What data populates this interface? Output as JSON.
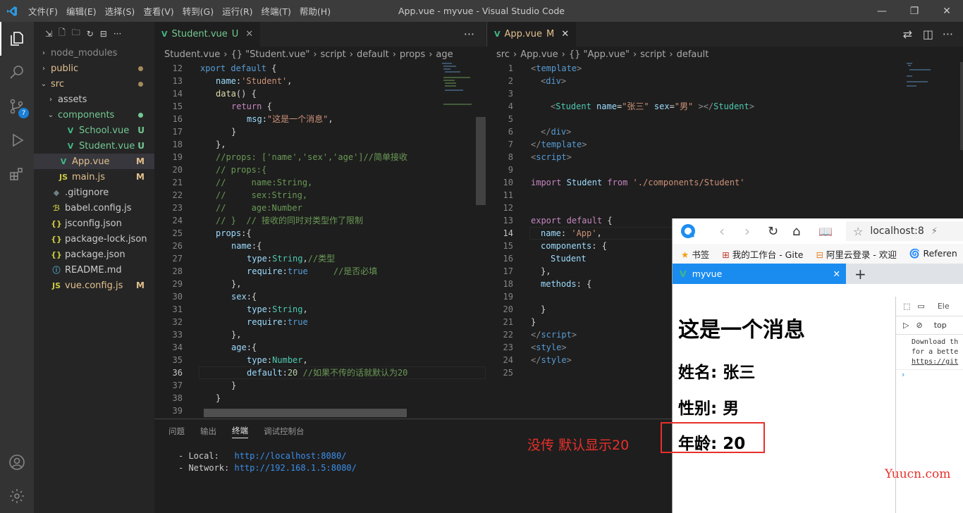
{
  "window": {
    "title": "App.vue - myvue - Visual Studio Code",
    "menu": [
      "文件(F)",
      "编辑(E)",
      "选择(S)",
      "查看(V)",
      "转到(G)",
      "运行(R)",
      "终端(T)",
      "帮助(H)"
    ],
    "controls": [
      "—",
      "❐",
      "✕"
    ]
  },
  "activity": {
    "scm_badge": "7"
  },
  "explorer": {
    "items": [
      {
        "label": "node_modules",
        "indent": 1,
        "chev": "›",
        "icon": "",
        "status": "",
        "color": "gray"
      },
      {
        "label": "public",
        "indent": 1,
        "chev": "›",
        "icon": "",
        "status": "dot",
        "color": "orange"
      },
      {
        "label": "src",
        "indent": 1,
        "chev": "⌄",
        "icon": "",
        "status": "dot",
        "color": "orange"
      },
      {
        "label": "assets",
        "indent": 2,
        "chev": "›",
        "icon": "",
        "status": "",
        "color": "plain"
      },
      {
        "label": "components",
        "indent": 2,
        "chev": "⌄",
        "icon": "",
        "status": "dotg",
        "color": "green"
      },
      {
        "label": "School.vue",
        "indent": 3,
        "chev": "",
        "icon": "V",
        "status": "U",
        "color": "green"
      },
      {
        "label": "Student.vue",
        "indent": 3,
        "chev": "",
        "icon": "V",
        "status": "U",
        "color": "green"
      },
      {
        "label": "App.vue",
        "indent": 2,
        "chev": "",
        "icon": "V",
        "status": "M",
        "color": "orange",
        "selected": true
      },
      {
        "label": "main.js",
        "indent": 2,
        "chev": "",
        "icon": "JS",
        "status": "M",
        "color": "orange"
      },
      {
        "label": ".gitignore",
        "indent": 1,
        "chev": "",
        "icon": "◆",
        "status": "",
        "color": "plain"
      },
      {
        "label": "babel.config.js",
        "indent": 1,
        "chev": "",
        "icon": "ℬ",
        "status": "",
        "color": "plain"
      },
      {
        "label": "jsconfig.json",
        "indent": 1,
        "chev": "",
        "icon": "{}",
        "status": "",
        "color": "plain"
      },
      {
        "label": "package-lock.json",
        "indent": 1,
        "chev": "",
        "icon": "{}",
        "status": "",
        "color": "plain"
      },
      {
        "label": "package.json",
        "indent": 1,
        "chev": "",
        "icon": "{}",
        "status": "",
        "color": "plain"
      },
      {
        "label": "README.md",
        "indent": 1,
        "chev": "",
        "icon": "ⓘ",
        "status": "",
        "color": "plain"
      },
      {
        "label": "vue.config.js",
        "indent": 1,
        "chev": "",
        "icon": "JS",
        "status": "M",
        "color": "orange"
      }
    ]
  },
  "editor_left": {
    "tab": {
      "label": "Student.vue",
      "status": "U"
    },
    "breadcrumb": [
      "Student.vue",
      "{} \"Student.vue\"",
      "script",
      "default",
      "props",
      "age"
    ],
    "current_line": 36,
    "lines": [
      {
        "n": 12,
        "html": "<span class='kw'>xport</span> <span class='kw'>default</span> {",
        "indent": 0
      },
      {
        "n": 13,
        "html": "<span class='prop'>name</span>:<span class='str'>'Student'</span>,",
        "indent": 1
      },
      {
        "n": 14,
        "html": "<span class='fn'>data</span>() {",
        "indent": 1
      },
      {
        "n": 15,
        "html": "<span class='kw2'>return</span> {",
        "indent": 2
      },
      {
        "n": 16,
        "html": "<span class='prop'>msg</span>:<span class='str'>\"这是一个消息\"</span>,",
        "indent": 3
      },
      {
        "n": 17,
        "html": "}",
        "indent": 2
      },
      {
        "n": 18,
        "html": "},",
        "indent": 1
      },
      {
        "n": 19,
        "html": "<span class='cm'>//props: ['name','sex','age']//简单接收</span>",
        "indent": 1
      },
      {
        "n": 20,
        "html": "<span class='cm'>// props:{</span>",
        "indent": 1
      },
      {
        "n": 21,
        "html": "<span class='cm'>//     name:String,</span>",
        "indent": 1
      },
      {
        "n": 22,
        "html": "<span class='cm'>//     sex:String,</span>",
        "indent": 1
      },
      {
        "n": 23,
        "html": "<span class='cm'>//     age:Number</span>",
        "indent": 1
      },
      {
        "n": 24,
        "html": "<span class='cm'>// }  // 接收的同时对类型作了限制</span>",
        "indent": 1
      },
      {
        "n": 25,
        "html": "<span class='prop'>props</span>:{",
        "indent": 1
      },
      {
        "n": 26,
        "html": "<span class='prop'>name</span>:{",
        "indent": 2
      },
      {
        "n": 27,
        "html": "<span class='prop'>type</span>:<span class='ty'>String</span>,<span class='cm'>//类型</span>",
        "indent": 3
      },
      {
        "n": 28,
        "html": "<span class='prop'>require</span>:<span class='kw'>true</span>     <span class='cm'>//是否必填</span>",
        "indent": 3
      },
      {
        "n": 29,
        "html": "},",
        "indent": 2
      },
      {
        "n": 30,
        "html": "<span class='prop'>sex</span>:{",
        "indent": 2
      },
      {
        "n": 31,
        "html": "<span class='prop'>type</span>:<span class='ty'>String</span>,",
        "indent": 3
      },
      {
        "n": 32,
        "html": "<span class='prop'>require</span>:<span class='kw'>true</span>",
        "indent": 3
      },
      {
        "n": 33,
        "html": "},",
        "indent": 2
      },
      {
        "n": 34,
        "html": "<span class='prop'>age</span>:{",
        "indent": 2
      },
      {
        "n": 35,
        "html": "<span class='prop'>type</span>:<span class='ty'>Number</span>,",
        "indent": 3
      },
      {
        "n": 36,
        "html": "<span class='prop'>default</span>:<span class='num'>20</span> <span class='cm'>//如果不传的话就默认为20</span>",
        "indent": 3
      },
      {
        "n": 37,
        "html": "}",
        "indent": 2
      },
      {
        "n": 38,
        "html": "}",
        "indent": 1
      },
      {
        "n": 39,
        "html": "",
        "indent": 0
      }
    ]
  },
  "editor_right": {
    "tab": {
      "label": "App.vue",
      "status": "M"
    },
    "breadcrumb": [
      "src",
      "App.vue",
      "{} \"App.vue\"",
      "script",
      "default"
    ],
    "current_line": 14,
    "lines": [
      {
        "n": 1,
        "html": "<span class='gray'>&lt;</span><span class='tag'>template</span><span class='gray'>&gt;</span>",
        "indent": 0
      },
      {
        "n": 2,
        "html": "<span class='gray'>&lt;</span><span class='tag'>div</span><span class='gray'>&gt;</span>",
        "indent": 1
      },
      {
        "n": 3,
        "html": "",
        "indent": 0
      },
      {
        "n": 4,
        "html": "<span class='gray'>&lt;</span><span class='ty'>Student</span> <span class='prop'>name</span>=<span class='str'>\"张三\"</span> <span class='prop'>sex</span>=<span class='str'>\"男\"</span> <span class='gray'>&gt;&lt;/</span><span class='ty'>Student</span><span class='gray'>&gt;</span>",
        "indent": 2
      },
      {
        "n": 5,
        "html": "",
        "indent": 0
      },
      {
        "n": 6,
        "html": "<span class='gray'>&lt;/</span><span class='tag'>div</span><span class='gray'>&gt;</span>",
        "indent": 1
      },
      {
        "n": 7,
        "html": "<span class='gray'>&lt;/</span><span class='tag'>template</span><span class='gray'>&gt;</span>",
        "indent": 0
      },
      {
        "n": 8,
        "html": "<span class='gray'>&lt;</span><span class='tag'>script</span><span class='gray'>&gt;</span>",
        "indent": 0
      },
      {
        "n": 9,
        "html": "",
        "indent": 0
      },
      {
        "n": 10,
        "html": "<span class='kw2'>import</span> <span class='prop'>Student</span> <span class='kw2'>from</span> <span class='str'>'./components/Student'</span>",
        "indent": 0
      },
      {
        "n": 11,
        "html": "",
        "indent": 0
      },
      {
        "n": 12,
        "html": "",
        "indent": 0
      },
      {
        "n": 13,
        "html": "<span class='kw2'>export</span> <span class='kw2'>default</span> {",
        "indent": 0
      },
      {
        "n": 14,
        "html": "<span class='prop'>name</span>: <span class='str'>'App'</span>,",
        "indent": 1
      },
      {
        "n": 15,
        "html": "<span class='prop'>components</span>: {",
        "indent": 1
      },
      {
        "n": 16,
        "html": "<span class='prop'>Student</span>",
        "indent": 2
      },
      {
        "n": 17,
        "html": "},",
        "indent": 1
      },
      {
        "n": 18,
        "html": "<span class='prop'>methods</span>: {",
        "indent": 1
      },
      {
        "n": 19,
        "html": "",
        "indent": 0
      },
      {
        "n": 20,
        "html": "}",
        "indent": 1
      },
      {
        "n": 21,
        "html": "}",
        "indent": 0
      },
      {
        "n": 22,
        "html": "<span class='gray'>&lt;/</span><span class='tag'>script</span><span class='gray'>&gt;</span>",
        "indent": 0
      },
      {
        "n": 23,
        "html": "<span class='gray'>&lt;</span><span class='tag'>style</span><span class='gray'>&gt;</span>",
        "indent": 0
      },
      {
        "n": 24,
        "html": "<span class='gray'>&lt;/</span><span class='tag'>style</span><span class='gray'>&gt;</span>",
        "indent": 0
      },
      {
        "n": 25,
        "html": "",
        "indent": 0
      }
    ]
  },
  "panel": {
    "tabs": [
      "问题",
      "输出",
      "终端",
      "调试控制台"
    ],
    "active": "终端",
    "terminal": {
      "local_label": "- Local:   ",
      "local_url": "http://localhost:8080/",
      "network_label": "- Network: ",
      "network_url": "http://192.168.1.5:8080/"
    }
  },
  "browser": {
    "address": "localhost:8",
    "bookmarks": [
      "书签",
      "我的工作台 - Gite",
      "阿里云登录 - 欢迎",
      "Referen"
    ],
    "tab_title": "myvue",
    "page": {
      "message": "这是一个消息",
      "name_line": "姓名: 张三",
      "sex_line": "性别: 男",
      "age_line": "年龄: 20"
    },
    "devtools": {
      "tab": "Ele",
      "context": "top",
      "console_lines": [
        "Download th",
        "for a bette",
        "https://git"
      ]
    }
  },
  "annotation": {
    "text": "没传  默认显示20",
    "watermark": "Yuucn.com",
    "color": "#e8302a"
  }
}
